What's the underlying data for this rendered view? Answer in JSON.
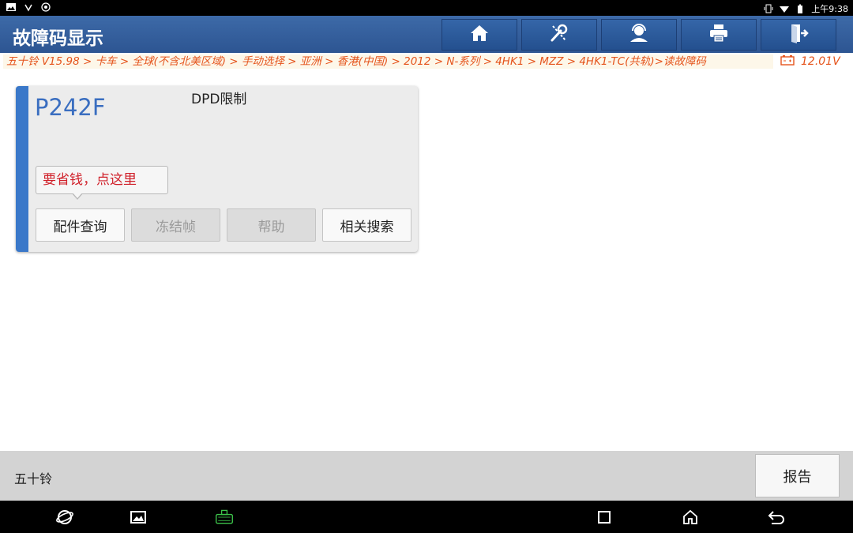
{
  "status_bar": {
    "time": "上午9:38"
  },
  "header": {
    "title": "故障码显示",
    "buttons": [
      {
        "name": "home",
        "icon": "home-icon"
      },
      {
        "name": "tools",
        "icon": "wrench-icon"
      },
      {
        "name": "support",
        "icon": "user-support-icon"
      },
      {
        "name": "print",
        "icon": "printer-icon"
      },
      {
        "name": "exit",
        "icon": "exit-icon"
      }
    ]
  },
  "breadcrumb": {
    "path": "五十铃 V15.98 > 卡车 > 全球(不含北美区域) > 手动选择 > 亚洲 > 香港(中国) > 2012 > N-系列 > 4HK1 > MZZ > 4HK1-TC(共轨)>读故障码",
    "voltage": "12.01V"
  },
  "dtc_card": {
    "code": "P242F",
    "description": "DPD限制",
    "tooltip": "要省钱，点这里",
    "buttons": {
      "parts_query": "配件查询",
      "freeze_frame": "冻结帧",
      "help": "帮助",
      "related_search": "相关搜索"
    }
  },
  "footer": {
    "brand": "五十铃",
    "report_label": "报告"
  },
  "colors": {
    "header_blue": "#2d5592",
    "accent_blue": "#3a78c9",
    "breadcrumb_orange": "#e5541c",
    "tooltip_red": "#d0202a"
  }
}
